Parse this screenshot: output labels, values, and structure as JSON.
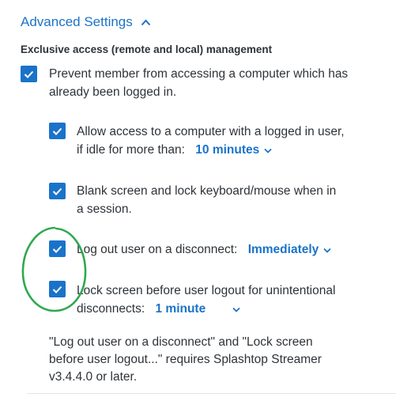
{
  "section": {
    "title": "Advanced Settings",
    "subheading": "Exclusive access (remote and local) management"
  },
  "options": {
    "prevent_access": {
      "checked": true,
      "line1": "Prevent member from accessing a computer which has",
      "line2": "already been logged in."
    },
    "allow_idle": {
      "checked": true,
      "line1": "Allow access to a computer with a logged in user,",
      "line2_prefix": "if idle for more than:",
      "dropdown_value": "10 minutes"
    },
    "blank_screen": {
      "checked": true,
      "line1": "Blank screen and lock keyboard/mouse when in",
      "line2": "a session."
    },
    "logout_disconnect": {
      "checked": true,
      "label": "Log out user on a disconnect:",
      "dropdown_value": "Immediately"
    },
    "lock_screen": {
      "checked": true,
      "line1": "Lock screen before user logout for unintentional",
      "line2_prefix": "disconnects:",
      "dropdown_value": "1 minute"
    }
  },
  "note": {
    "line1": "\"Log out user on a disconnect\" and \"Lock screen",
    "line2": "before user logout...\" requires Splashtop Streamer",
    "line3": "v3.4.4.0 or later."
  },
  "colors": {
    "accent": "#1a73c9",
    "text": "#2e3338",
    "annotation": "#2fa84f"
  }
}
